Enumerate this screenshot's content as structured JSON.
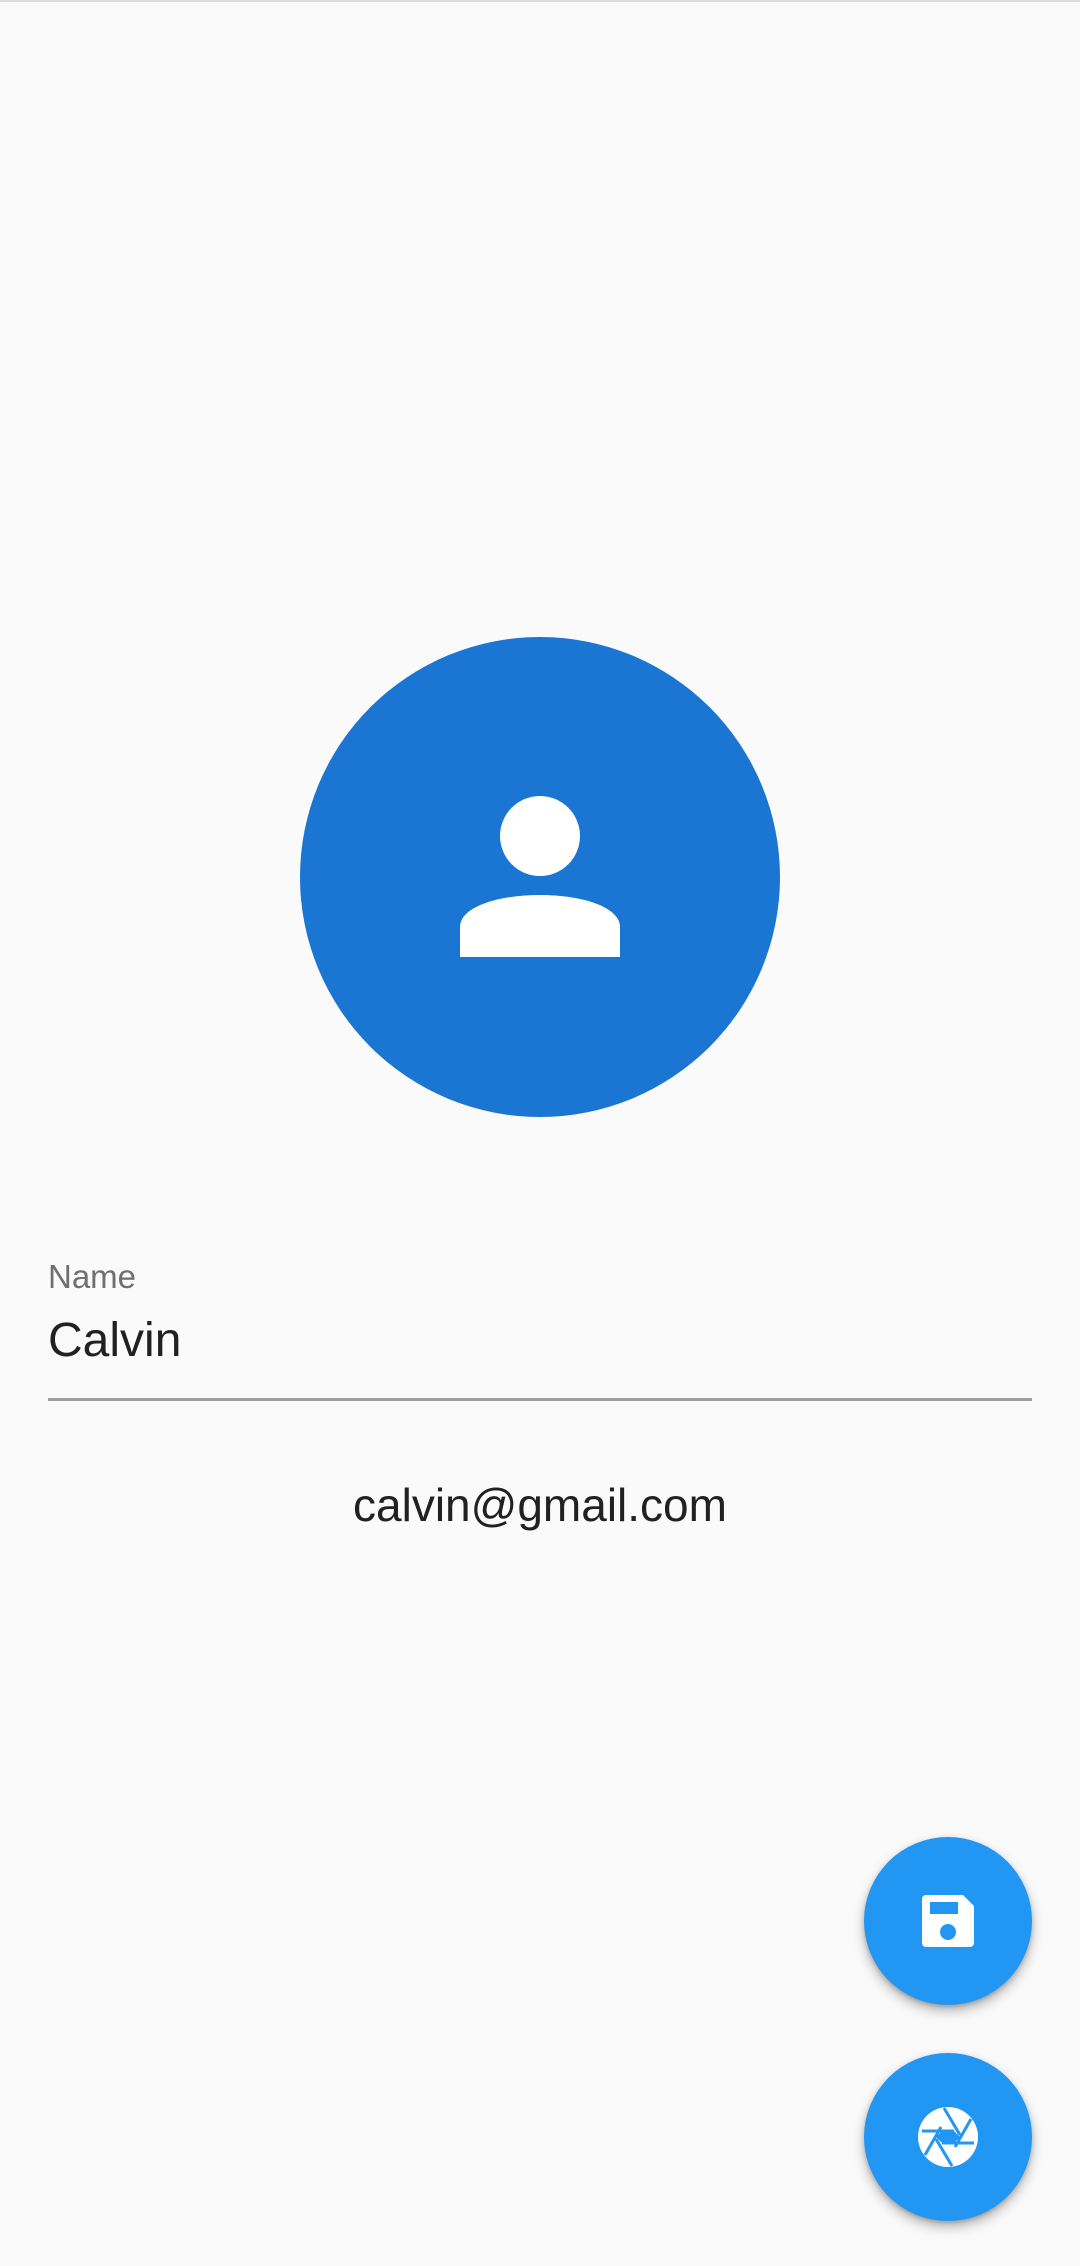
{
  "colors": {
    "background": "#fafafa",
    "avatar_bg": "#1a76d2",
    "fab_bg": "#2196f3",
    "icon": "#ffffff"
  },
  "avatar": {
    "icon": "person-icon"
  },
  "name_field": {
    "label": "Name",
    "value": "Calvin"
  },
  "email": {
    "text": "calvin@gmail.com"
  },
  "fabs": {
    "save": {
      "icon": "save-icon"
    },
    "camera": {
      "icon": "camera-aperture-icon"
    }
  }
}
